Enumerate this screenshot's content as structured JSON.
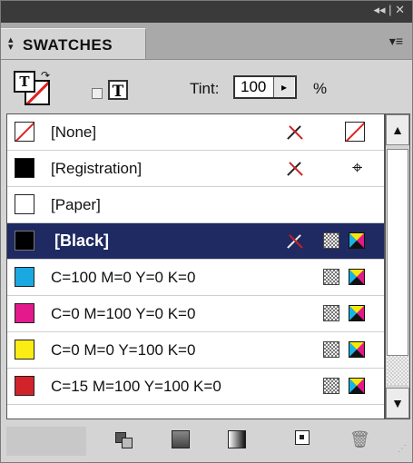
{
  "window": {
    "controls": "◂◂ | ✕"
  },
  "tab": {
    "title": "SWATCHES",
    "arrows_icon": "up-down-arrows",
    "menu_icon": "panel-menu"
  },
  "toolbar": {
    "fill_text": "T",
    "formatting_text_icon": "T",
    "tint_label": "Tint:",
    "tint_value": "100",
    "tint_stepper_glyph": "▸",
    "percent": "%"
  },
  "swatches": [
    {
      "name": "[None]",
      "color": "#ffffff",
      "lock": true,
      "mode": "none"
    },
    {
      "name": "[Registration]",
      "color": "#000000",
      "lock": true,
      "mode": "registration"
    },
    {
      "name": "[Paper]",
      "color": "#ffffff",
      "lock": false,
      "mode": ""
    },
    {
      "name": "[Black]",
      "color": "#000000",
      "lock": true,
      "mode": "process-cmyk",
      "selected": true
    },
    {
      "name": "C=100 M=0 Y=0 K=0",
      "color": "#1ba8e0",
      "lock": false,
      "mode": "process-cmyk"
    },
    {
      "name": "C=0 M=100 Y=0 K=0",
      "color": "#e3198c",
      "lock": false,
      "mode": "process-cmyk"
    },
    {
      "name": "C=0 M=0 Y=100 K=0",
      "color": "#fbec15",
      "lock": false,
      "mode": "process-cmyk"
    },
    {
      "name": "C=15 M=100 Y=100 K=0",
      "color": "#d2232a",
      "lock": false,
      "mode": "process-cmyk"
    }
  ],
  "scrollbar": {
    "up_glyph": "▲",
    "down_glyph": "▼"
  },
  "bottom": {
    "trash_glyph": "🗑",
    "grip_glyph": "⋰"
  },
  "colors": {
    "selected_row": "#1f2a63",
    "panel_bg": "#d4d4d4",
    "title_bar": "#3a3a3a"
  }
}
